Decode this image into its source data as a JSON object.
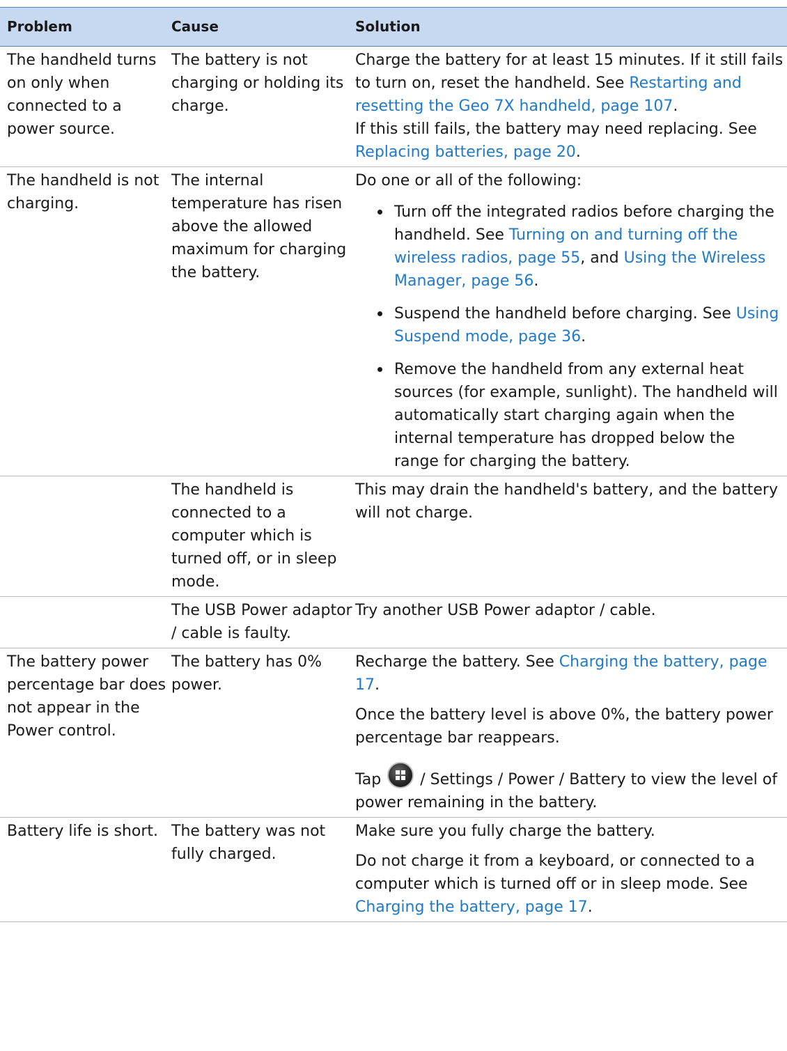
{
  "table": {
    "headers": {
      "problem": "Problem",
      "cause": "Cause",
      "solution": "Solution"
    },
    "rows": [
      {
        "problem": "The handheld turns on only when connected to a power source.",
        "cause": "The battery is not charging or holding its charge.",
        "s1_text": "Charge the battery for at least 15 minutes. If it still fails to turn on, reset the handheld. See ",
        "s1_link": "Restarting and resetting the Geo 7X handheld, page 107",
        "s1_end": ".",
        "s2_text": "If this still fails, the battery may need replacing. See ",
        "s2_link": "Replacing batteries, page 20",
        "s2_end": "."
      },
      {
        "problem": "The handheld is not charging.",
        "cause": "The internal temperature has risen above the allowed maximum for charging the battery.",
        "intro": "Do one or all of the following:",
        "b1_text": "Turn off the integrated radios before charging the handheld. See ",
        "b1_link1": "Turning on and turning off the wireless radios, page 55",
        "b1_mid": ", and ",
        "b1_link2": "Using the Wireless Manager, page 56",
        "b1_end": ".",
        "b2_text": "Suspend the handheld before charging. See ",
        "b2_link": "Using Suspend mode, page 36",
        "b2_end": ".",
        "b3_text": "Remove the handheld from any external heat sources (for example, sunlight). The handheld will automatically start charging again when the internal temperature has dropped below the range for charging the battery."
      },
      {
        "problem": "",
        "cause": "The handheld is connected to a computer which is turned off, or in sleep mode.",
        "solution": "This may drain the handheld's battery, and the battery will not charge."
      },
      {
        "problem": "",
        "cause": "The USB Power adaptor / cable is faulty.",
        "solution": "Try another USB Power adaptor / cable."
      },
      {
        "problem": "The battery power percentage bar does not appear in the Power control.",
        "cause": "The battery has 0% power.",
        "s1_text": "Recharge the battery. See ",
        "s1_link": "Charging the battery, page 17",
        "s1_end": ".",
        "s2_text": "Once the battery level is above 0%, the battery power percentage bar reappears.",
        "s3_pre": "Tap ",
        "s3_post": " / Settings / Power / Battery to view the level of power remaining in the battery.",
        "icon": "windows-start-icon"
      },
      {
        "problem": "Battery life is short.",
        "cause": "The battery was not fully charged.",
        "s1_text": "Make sure you fully charge the battery.",
        "s2_text": "Do not charge it from a keyboard, or connected to a computer which is turned off or in sleep mode. See ",
        "s2_link": "Charging the battery, page 17",
        "s2_end": "."
      }
    ]
  },
  "colors": {
    "header_bg": "#c6d9f1",
    "link": "#1f7ac8",
    "text": "#1a1a1a"
  }
}
